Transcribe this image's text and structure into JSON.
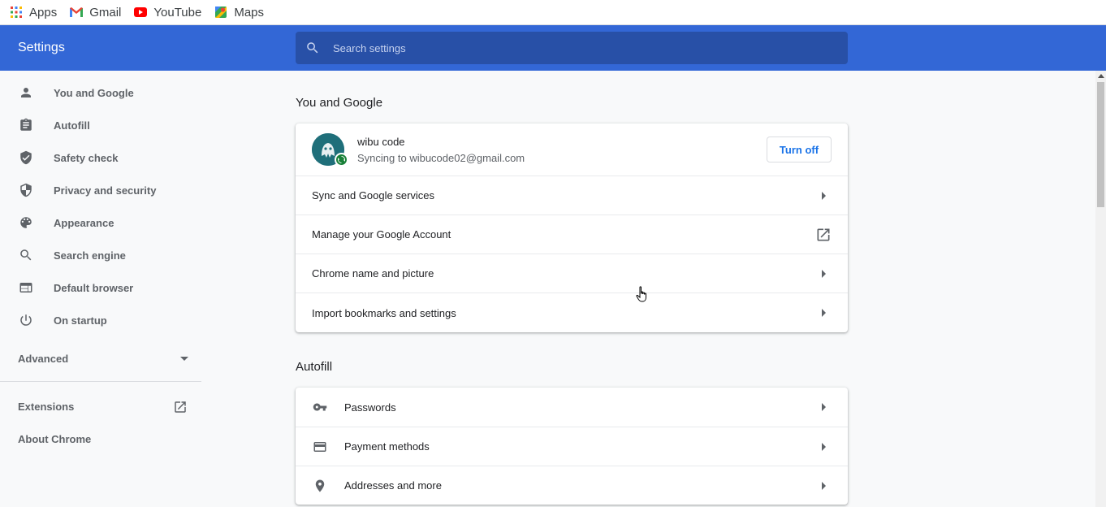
{
  "bookmarks": [
    {
      "label": "Apps",
      "icon": "apps-grid-icon"
    },
    {
      "label": "Gmail",
      "icon": "gmail-icon"
    },
    {
      "label": "YouTube",
      "icon": "youtube-icon"
    },
    {
      "label": "Maps",
      "icon": "maps-icon"
    }
  ],
  "header": {
    "title": "Settings",
    "search_placeholder": "Search settings"
  },
  "sidebar": {
    "items": [
      {
        "label": "You and Google",
        "icon": "person-icon"
      },
      {
        "label": "Autofill",
        "icon": "clipboard-icon"
      },
      {
        "label": "Safety check",
        "icon": "shield-check-icon"
      },
      {
        "label": "Privacy and security",
        "icon": "shield-icon"
      },
      {
        "label": "Appearance",
        "icon": "palette-icon"
      },
      {
        "label": "Search engine",
        "icon": "search-icon"
      },
      {
        "label": "Default browser",
        "icon": "browser-icon"
      },
      {
        "label": "On startup",
        "icon": "power-icon"
      }
    ],
    "advanced_label": "Advanced",
    "extensions_label": "Extensions",
    "about_label": "About Chrome"
  },
  "you_and_google": {
    "title": "You and Google",
    "account_name": "wibu code",
    "sync_status": "Syncing to wibucode02@gmail.com",
    "turn_off_label": "Turn off",
    "rows": [
      {
        "label": "Sync and Google services",
        "trailing": "arrow"
      },
      {
        "label": "Manage your Google Account",
        "trailing": "external"
      },
      {
        "label": "Chrome name and picture",
        "trailing": "arrow"
      },
      {
        "label": "Import bookmarks and settings",
        "trailing": "arrow"
      }
    ]
  },
  "autofill": {
    "title": "Autofill",
    "rows": [
      {
        "label": "Passwords",
        "icon": "key-icon"
      },
      {
        "label": "Payment methods",
        "icon": "credit-card-icon"
      },
      {
        "label": "Addresses and more",
        "icon": "location-pin-icon"
      }
    ]
  },
  "colors": {
    "header_bg": "#3367d6",
    "search_bg": "#2850a7",
    "accent": "#1a73e8",
    "sync_badge": "#188038"
  }
}
